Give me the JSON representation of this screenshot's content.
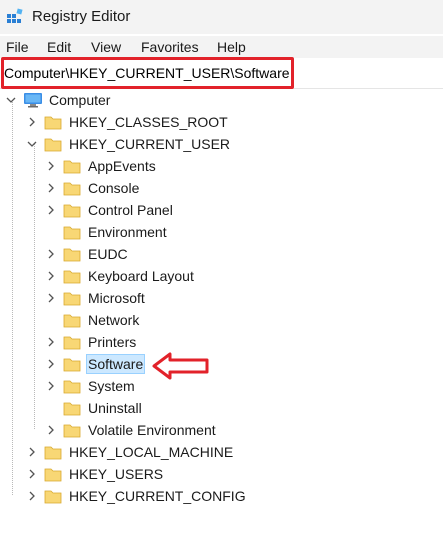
{
  "window": {
    "title": "Registry Editor",
    "icon": "registry-editor-icon"
  },
  "menu": {
    "items": [
      "File",
      "Edit",
      "View",
      "Favorites",
      "Help"
    ]
  },
  "address": {
    "path": "Computer\\HKEY_CURRENT_USER\\Software"
  },
  "tree": {
    "root": "Computer",
    "hives": {
      "classes_root": "HKEY_CLASSES_ROOT",
      "current_user": "HKEY_CURRENT_USER",
      "local_machine": "HKEY_LOCAL_MACHINE",
      "users": "HKEY_USERS",
      "current_config": "HKEY_CURRENT_CONFIG"
    },
    "current_user_children": [
      "AppEvents",
      "Console",
      "Control Panel",
      "Environment",
      "EUDC",
      "Keyboard Layout",
      "Microsoft",
      "Network",
      "Printers",
      "Software",
      "System",
      "Uninstall",
      "Volatile Environment"
    ],
    "selected": "Software"
  },
  "colors": {
    "annotation_red": "#e2222a",
    "selection_fill": "#cce8ff",
    "selection_border": "#99d1ff",
    "folder_yellow": "#f8d775"
  }
}
